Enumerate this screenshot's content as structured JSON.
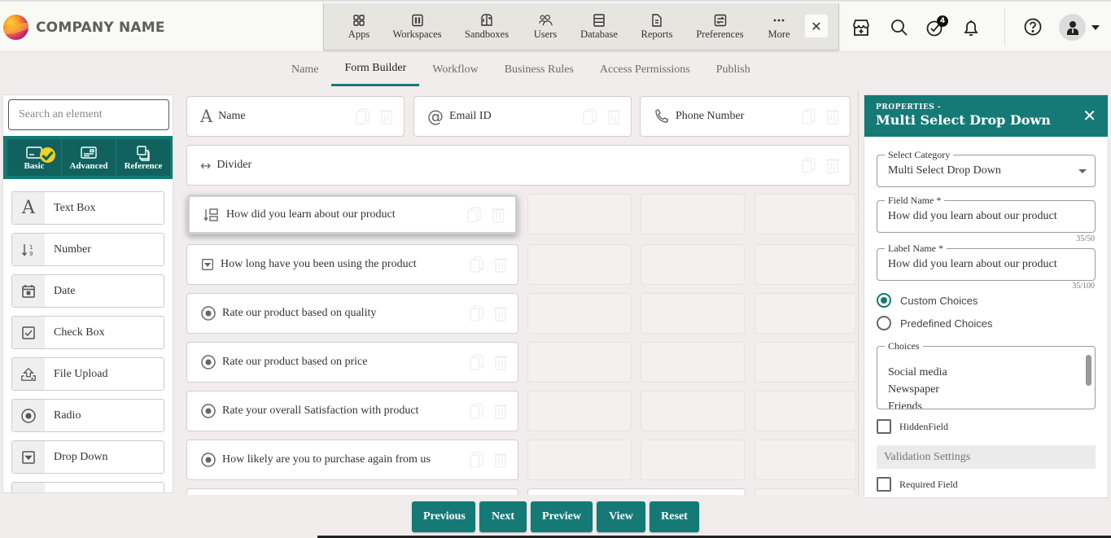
{
  "header": {
    "company_name": "COMPANY NAME",
    "nav": [
      {
        "label": "Apps",
        "icon": "apps-icon"
      },
      {
        "label": "Workspaces",
        "icon": "workspaces-icon"
      },
      {
        "label": "Sandboxes",
        "icon": "sandboxes-icon"
      },
      {
        "label": "Users",
        "icon": "users-icon"
      },
      {
        "label": "Database",
        "icon": "database-icon"
      },
      {
        "label": "Reports",
        "icon": "reports-icon"
      },
      {
        "label": "Preferences",
        "icon": "preferences-icon"
      },
      {
        "label": "More",
        "icon": "more-icon"
      }
    ],
    "close_label": "✕",
    "tasks_badge": "4"
  },
  "steps": [
    {
      "label": "Name",
      "active": false
    },
    {
      "label": "Form Builder",
      "active": true
    },
    {
      "label": "Workflow",
      "active": false
    },
    {
      "label": "Business Rules",
      "active": false
    },
    {
      "label": "Access Permissions",
      "active": false
    },
    {
      "label": "Publish",
      "active": false
    }
  ],
  "left_panel": {
    "search_placeholder": "Search an element",
    "tabs": [
      {
        "label": "Basic",
        "selected": true
      },
      {
        "label": "Advanced",
        "selected": false
      },
      {
        "label": "Reference",
        "selected": false
      }
    ],
    "elements": [
      {
        "label": "Text Box",
        "icon": "text-box-icon"
      },
      {
        "label": "Number",
        "icon": "number-icon"
      },
      {
        "label": "Date",
        "icon": "calendar-icon"
      },
      {
        "label": "Check Box",
        "icon": "checkbox-icon"
      },
      {
        "label": "File Upload",
        "icon": "file-upload-icon"
      },
      {
        "label": "Radio",
        "icon": "radio-icon"
      },
      {
        "label": "Drop Down",
        "icon": "dropdown-icon"
      }
    ]
  },
  "canvas": {
    "fields": [
      {
        "label": "Name",
        "icon": "text-icon"
      },
      {
        "label": "Email ID",
        "icon": "at-icon"
      },
      {
        "label": "Phone Number",
        "icon": "phone-icon"
      },
      {
        "label": "Divider",
        "icon": "divider-icon"
      },
      {
        "label": "How did you learn about our product",
        "icon": "multi-select-icon",
        "selected": true
      },
      {
        "label": "How long have you been using the product",
        "icon": "dropdown-icon"
      },
      {
        "label": "Rate our product based on quality",
        "icon": "radio-icon"
      },
      {
        "label": "Rate our product based on price",
        "icon": "radio-icon"
      },
      {
        "label": "Rate your overall Satisfaction with product",
        "icon": "radio-icon"
      },
      {
        "label": "How likely are you to purchase again from us",
        "icon": "radio-icon"
      }
    ]
  },
  "properties": {
    "subtitle": "PROPERTIES -",
    "title": "Multi Select Drop Down",
    "select_category_label": "Select Category",
    "select_category_value": "Multi Select Drop Down",
    "field_name_label": "Field Name *",
    "field_name_value": "How did you learn about our product",
    "field_name_counter": "35/50",
    "label_name_label": "Label Name *",
    "label_name_value": "How did you learn about our product",
    "label_name_counter": "35/100",
    "custom_choices_label": "Custom Choices",
    "predefined_choices_label": "Predefined Choices",
    "choices_mode": "custom",
    "choices_label": "Choices",
    "choices": [
      "Social media",
      "Newspaper",
      "Friends"
    ],
    "hidden_field_label": "HiddenField",
    "hidden_field_checked": false,
    "validation_settings_label": "Validation Settings",
    "required_field_label": "Required Field",
    "required_field_checked": false
  },
  "footer": {
    "buttons": [
      "Previous",
      "Next",
      "Preview",
      "View",
      "Reset"
    ]
  },
  "colors": {
    "accent": "#157a75",
    "badge_yellow": "#f2d21d"
  }
}
